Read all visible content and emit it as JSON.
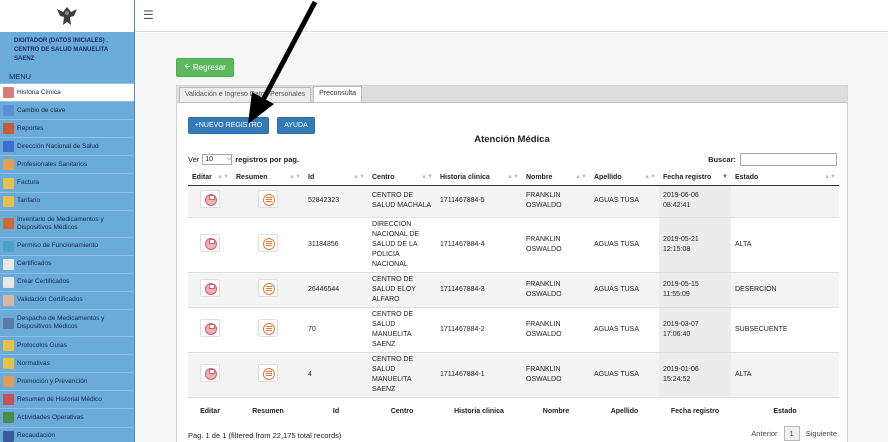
{
  "sidebar": {
    "user_info": "DIGITADOR (DATOS INICIALES) . CENTRO DE SALUD MANUELITA SAENZ",
    "menu_title": "MENU",
    "items": [
      {
        "label": "Historia Clínica",
        "color": "#d97b7b",
        "active": true
      },
      {
        "label": "Cambio de clave",
        "color": "#5b8fd6"
      },
      {
        "label": "Reportes",
        "color": "#c85a3a"
      },
      {
        "label": "Dirección Nacional de Salud",
        "color": "#3a6fd0"
      },
      {
        "label": "Profesionales Sanitarios",
        "color": "#e0a05a"
      },
      {
        "label": "Factura",
        "color": "#e6c24c"
      },
      {
        "label": "Tarifario",
        "color": "#e6c24c"
      },
      {
        "label": "Inventario de Medicamentos y Dispositivos Médicos",
        "color": "#c86a3a",
        "tall": true
      },
      {
        "label": "Permiso de Funcionamiento",
        "color": "#4ba3c8"
      },
      {
        "label": "Certificados",
        "color": "#e8e8e8"
      },
      {
        "label": "Crear Certificados",
        "color": "#e8e8e8"
      },
      {
        "label": "Validación Certificados",
        "color": "#d8b6a6"
      },
      {
        "label": "Despacho de Medicamentos y Dispositivos Médicos",
        "color": "#5a7aa8",
        "tall": true
      },
      {
        "label": "Protocolos Guías",
        "color": "#e8c04a"
      },
      {
        "label": "Normativas",
        "color": "#e8c04a"
      },
      {
        "label": "Promoción y Prevención",
        "color": "#e09a5a"
      },
      {
        "label": "Resumen de Historial Médico",
        "color": "#c8505a"
      },
      {
        "label": "Actividades Operativas",
        "color": "#4a8a4a"
      },
      {
        "label": "Recaudación",
        "color": "#3a5a9a"
      }
    ]
  },
  "content": {
    "regresar_label": "Regresar",
    "tabs": [
      "Validación e Ingreso Datos Personales",
      "Preconsulta"
    ],
    "nuevo_label": "NUEVO REGISTRO",
    "ayuda_label": "AYUDA",
    "title": "Atención Médica",
    "ver_prefix": "Ver",
    "ver_value": "10",
    "ver_suffix": "registros por pag.",
    "buscar_label": "Buscar:",
    "columns": [
      "Editar",
      "Resumen",
      "Id",
      "Centro",
      "Historia clinica",
      "Nombre",
      "Apellido",
      "Fecha registro",
      "Estado"
    ],
    "rows": [
      {
        "id": "52842323",
        "centro": "CENTRO DE SALUD MACHALA",
        "historia": "1711467884-5",
        "nombre": "FRANKLIN OSWALDO",
        "apellido": "AGUAS TUSA",
        "fecha": "2019-06-06 08:42:41",
        "estado": ""
      },
      {
        "id": "31184856",
        "centro": "DIRECCION NACIONAL DE SALUD DE LA POLICIA NACIONAL",
        "historia": "1711467884-4",
        "nombre": "FRANKLIN OSWALDO",
        "apellido": "AGUAS TUSA",
        "fecha": "2019-05-21 12:15:08",
        "estado": "ALTA"
      },
      {
        "id": "26446544",
        "centro": "CENTRO DE SALUD ELOY ALFARO",
        "historia": "1711467884-3",
        "nombre": "FRANKLIN OSWALDO",
        "apellido": "AGUAS TUSA",
        "fecha": "2019-05-15 11:55:09",
        "estado": "DESERCIÓN"
      },
      {
        "id": "70",
        "centro": "CENTRO DE SALUD MANUELITA SAENZ",
        "historia": "1711467884-2",
        "nombre": "FRANKLIN OSWALDO",
        "apellido": "AGUAS TUSA",
        "fecha": "2019-03-07 17:06:40",
        "estado": "SUBSECUENTE"
      },
      {
        "id": "4",
        "centro": "CENTRO DE SALUD MANUELITA SAENZ",
        "historia": "1711467884-1",
        "nombre": "FRANKLIN OSWALDO",
        "apellido": "AGUAS TUSA",
        "fecha": "2019-01-06 15:24:52",
        "estado": "ALTA"
      }
    ],
    "pag_info": "Pag. 1 de 1 (filtered from 22,175 total records)",
    "pager_prev": "Anterior",
    "pager_page": "1",
    "pager_next": "Siguiente"
  },
  "colors": {
    "sidebar_bg": "#6aabd9",
    "primary": "#337ab7",
    "success": "#5cb85c"
  }
}
